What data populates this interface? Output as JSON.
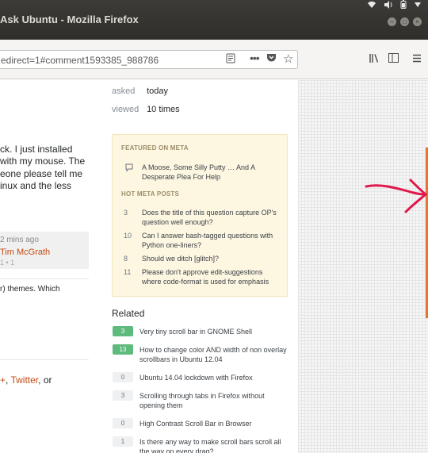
{
  "window": {
    "title": "Ask Ubuntu - Mozilla Firefox",
    "tray_icons": [
      "wifi-icon",
      "volume-icon",
      "battery-icon",
      "power-icon"
    ]
  },
  "navbar": {
    "url": "edirect=1#comment1593385_988786"
  },
  "question": {
    "asked_label": "asked",
    "asked_value": "today",
    "viewed_label": "viewed",
    "viewed_value": "10 times",
    "body_lines": [
      "ck. I just installed",
      "with my mouse. The",
      "eone please tell me",
      "inux and the less"
    ],
    "comment": {
      "time": "2 mins ago",
      "user": "Tim McGrath",
      "stats": "1  • 1"
    },
    "themes_text": "r) themes. Which",
    "share": {
      "plus": "+",
      "sep1": ", ",
      "twitter": "Twitter",
      "tail": ", or"
    }
  },
  "sidebar": {
    "featured_heading": "FEATURED ON META",
    "featured_items": [
      {
        "title": "A Moose, Some Silly Putty … And A Desperate Plea For Help"
      }
    ],
    "hot_heading": "HOT META POSTS",
    "hot_items": [
      {
        "count": "3",
        "title": "Does the title of this question capture OP's question well enough?"
      },
      {
        "count": "10",
        "title": "Can I answer bash-tagged questions with Python one-liners?"
      },
      {
        "count": "8",
        "title": "Should we ditch [glitch]?"
      },
      {
        "count": "11",
        "title": "Please don't approve edit-suggestions where code-format is used for emphasis"
      }
    ]
  },
  "related": {
    "heading": "Related",
    "items": [
      {
        "score": "3",
        "answered": true,
        "title": "Very tiny scroll bar in GNOME Shell"
      },
      {
        "score": "13",
        "answered": true,
        "title": "How to change color AND width of non overlay scrollbars in Ubuntu 12.04"
      },
      {
        "score": "0",
        "answered": false,
        "title": "Ubuntu 14.04 lockdown with Firefox"
      },
      {
        "score": "3",
        "answered": false,
        "title": "Scrolling through tabs in Firefox without opening them"
      },
      {
        "score": "0",
        "answered": false,
        "title": "High Contrast Scroll Bar in Browser"
      },
      {
        "score": "1",
        "answered": false,
        "title": "Is there any way to make scroll bars scroll all the way on every drag?"
      }
    ]
  },
  "colors": {
    "accent_link": "#c44b12",
    "answered_badge": "#5eba7d",
    "scrollbar_thumb": "#e8742f",
    "annotation_arrow": "#e0194d"
  }
}
